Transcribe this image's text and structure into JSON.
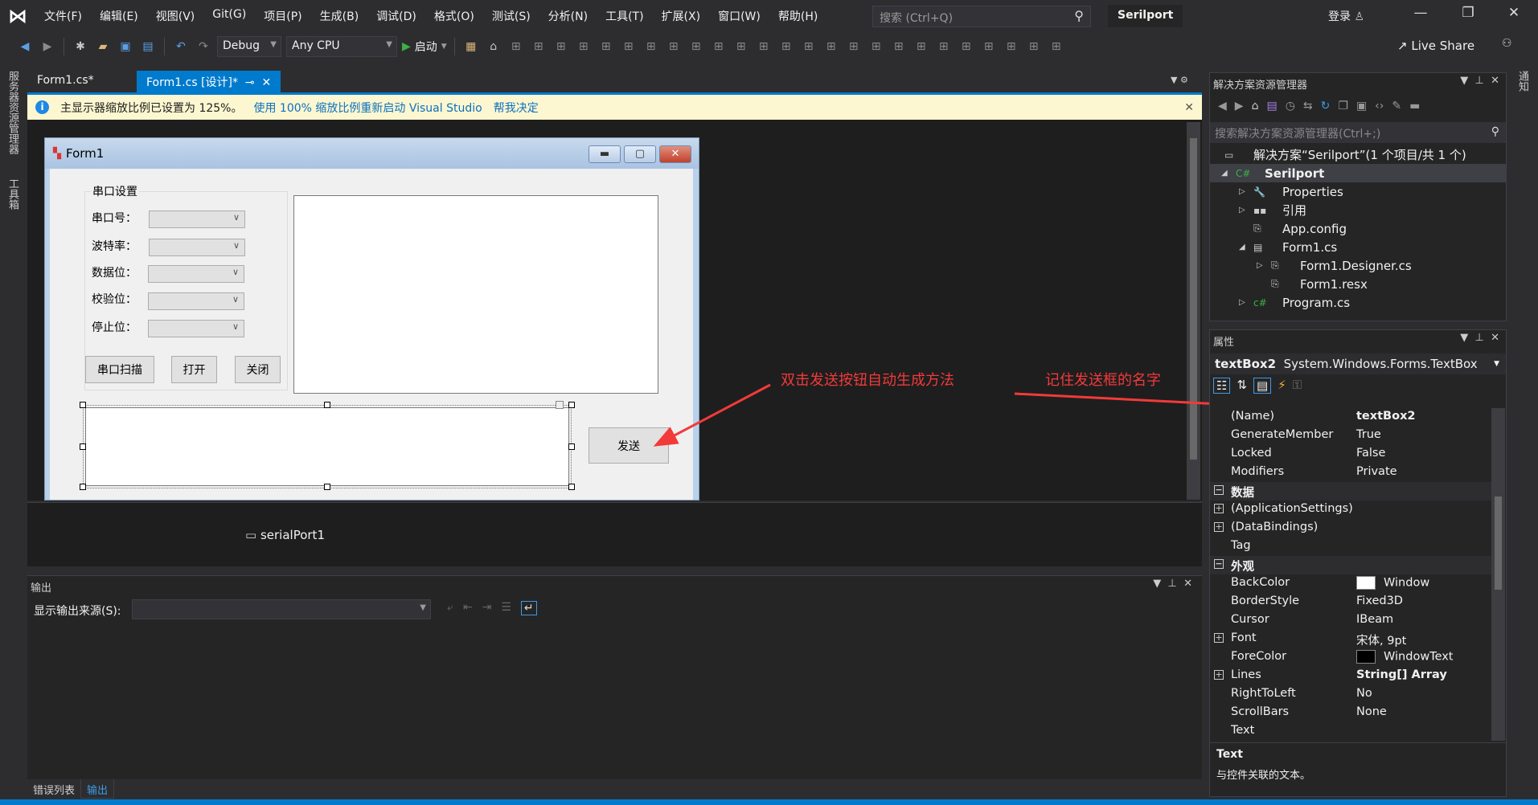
{
  "menubar": {
    "items": [
      "文件(F)",
      "编辑(E)",
      "视图(V)",
      "Git(G)",
      "项目(P)",
      "生成(B)",
      "调试(D)",
      "格式(O)",
      "测试(S)",
      "分析(N)",
      "工具(T)",
      "扩展(X)",
      "窗口(W)",
      "帮助(H)"
    ],
    "search_placeholder": "搜索 (Ctrl+Q)",
    "solution_name": "Serilport",
    "login": "登录"
  },
  "toolbar": {
    "config": "Debug",
    "platform": "Any CPU",
    "start": "启动",
    "live_share": "Live Share"
  },
  "side_tabs": {
    "left": [
      "服务器资源管理器",
      "工具箱"
    ],
    "right": "通知"
  },
  "doc_tabs": [
    {
      "label": "Form1.cs*"
    },
    {
      "label": "Form1.cs [设计]*"
    }
  ],
  "infobar": {
    "message": "主显示器缩放比例已设置为 125%。",
    "link1": "使用 100% 缩放比例重新启动 Visual Studio",
    "link2": "帮我决定"
  },
  "designer": {
    "form_title": "Form1",
    "group_title": "串口设置",
    "labels": [
      "串口号：",
      "波特率：",
      "数据位：",
      "校验位：",
      "停止位："
    ],
    "buttons": {
      "scan": "串口扫描",
      "open": "打开",
      "close": "关闭",
      "send": "发送"
    },
    "tray_component": "serialPort1"
  },
  "annotations": {
    "send_button_note": "双击发送按钮自动生成方法",
    "name_note": "记住发送框的名字",
    "color": "#f23a3a"
  },
  "output": {
    "title": "输出",
    "source_label": "显示输出来源(S):",
    "source_value": ""
  },
  "bottom_tabs": [
    "错误列表",
    "输出"
  ],
  "solution_explorer": {
    "title": "解决方案资源管理器",
    "search_placeholder": "搜索解决方案资源管理器(Ctrl+;)",
    "items": [
      {
        "label": "解决方案“Serilport”(1 个项目/共 1 个)",
        "icon": "solution-icon"
      },
      {
        "label": "Serilport",
        "icon": "csharp-project-icon"
      },
      {
        "label": "Properties",
        "icon": "wrench-icon"
      },
      {
        "label": "引用",
        "icon": "references-icon"
      },
      {
        "label": "App.config",
        "icon": "config-file-icon"
      },
      {
        "label": "Form1.cs",
        "icon": "form-icon"
      },
      {
        "label": "Form1.Designer.cs",
        "icon": "file-icon"
      },
      {
        "label": "Form1.resx",
        "icon": "file-icon"
      },
      {
        "label": "Program.cs",
        "icon": "csharp-file-icon"
      }
    ]
  },
  "properties": {
    "title": "属性",
    "object_name": "textBox2",
    "object_type": "System.Windows.Forms.TextBox",
    "rows": [
      {
        "name": "(Name)",
        "value": "textBox2",
        "bold": true
      },
      {
        "name": "GenerateMember",
        "value": "True"
      },
      {
        "name": "Locked",
        "value": "False"
      },
      {
        "name": "Modifiers",
        "value": "Private"
      },
      {
        "category": "数据"
      },
      {
        "name": "(ApplicationSettings)",
        "value": "",
        "expandable": true
      },
      {
        "name": "(DataBindings)",
        "value": "",
        "expandable": true
      },
      {
        "name": "Tag",
        "value": ""
      },
      {
        "category": "外观"
      },
      {
        "name": "BackColor",
        "value": "Window",
        "swatch": "#ffffff"
      },
      {
        "name": "BorderStyle",
        "value": "Fixed3D"
      },
      {
        "name": "Cursor",
        "value": "IBeam"
      },
      {
        "name": "Font",
        "value": "宋体, 9pt",
        "expandable": true
      },
      {
        "name": "ForeColor",
        "value": "WindowText",
        "swatch": "#000000"
      },
      {
        "name": "Lines",
        "value": "String[] Array",
        "bold": true,
        "expandable": true
      },
      {
        "name": "RightToLeft",
        "value": "No"
      },
      {
        "name": "ScrollBars",
        "value": "None"
      },
      {
        "name": "Text",
        "value": ""
      }
    ],
    "description_title": "Text",
    "description": "与控件关联的文本。"
  },
  "colors": {
    "accent": "#007acc",
    "background": "#2d2d30",
    "canvas": "#1e1e1e"
  }
}
